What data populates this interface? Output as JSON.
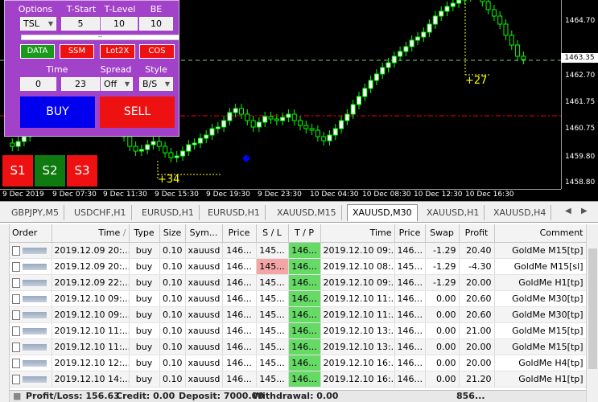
{
  "chart": {
    "price_labels": [
      "1464.70",
      "1463.35",
      "1462.70",
      "1461.75",
      "1460.75",
      "1459.80",
      "1458.80"
    ],
    "current_price": "1463.35",
    "time_labels": [
      "9 Dec 2019",
      "9 Dec 07:30",
      "9 Dec 11:30",
      "9 Dec 15:30",
      "9 Dec 19:30",
      "9 Dec 23:30",
      "10 Dec 04:30",
      "10 Dec 08:30",
      "10 Dec 12:30",
      "10 Dec 16:30"
    ],
    "pips_left": "+34",
    "pips_right": "+27",
    "colors": {
      "bull": "#00ff00",
      "bear": "#00ff00",
      "body_bear": "#000000",
      "body_bull": "#ffffff",
      "bid_line": "#ff0000",
      "ask_line": "#ffff00"
    }
  },
  "panel": {
    "labels": {
      "options": "Options",
      "tstart": "T-Start",
      "tlevel": "T-Level",
      "be": "BE",
      "time": "Time",
      "spread": "Spread",
      "style": "Style"
    },
    "options_value": "TSL",
    "tstart_value": "5",
    "tlevel_value": "10",
    "be_value": "10",
    "bar_text": "--",
    "mode_buttons": [
      "DATA",
      "SSM",
      "Lot2X",
      "COS"
    ],
    "time_from": "0",
    "time_to": "23",
    "spread_value": "Off",
    "style_value": "B/S",
    "buy_label": "BUY",
    "sell_label": "SELL",
    "s_buttons": [
      "S1",
      "S2",
      "S3"
    ]
  },
  "tabs": [
    "GBPJPY,M5",
    "USDCHF,H1",
    "EURUSD,H1",
    "EURUSD,H1",
    "XAUUSD,M15",
    "XAUUSD,M30",
    "XAUUSD,H1",
    "XAUUSD,H4"
  ],
  "active_tab": "XAUUSD,M30",
  "table": {
    "headers": [
      "Order",
      "Time",
      "Type",
      "Size",
      "Sym...",
      "Price",
      "S / L",
      "T / P",
      "Time",
      "Price",
      "Swap",
      "Profit",
      "Comment"
    ],
    "rows": [
      {
        "time": "2019.12.09 20:...",
        "type": "buy",
        "size": "0.10",
        "symbol": "xauusd",
        "price": "146...",
        "sl": "145...",
        "tp": "146...",
        "close_time": "2019.12.10 09:...",
        "close_price": "146...",
        "swap": "-1.29",
        "profit": "20.40",
        "comment": "GoldMe M15[tp]"
      },
      {
        "time": "2019.12.09 20:...",
        "type": "buy",
        "size": "0.10",
        "symbol": "xauusd",
        "price": "146...",
        "sl": "145...",
        "tp": "146...",
        "close_time": "2019.12.10 08:...",
        "close_price": "145...",
        "swap": "-1.29",
        "profit": "-4.30",
        "comment": "GoldMe M15[sl]"
      },
      {
        "time": "2019.12.09 22:...",
        "type": "buy",
        "size": "0.10",
        "symbol": "xauusd",
        "price": "146...",
        "sl": "145...",
        "tp": "146...",
        "close_time": "2019.12.10 09:...",
        "close_price": "146...",
        "swap": "-1.29",
        "profit": "20.00",
        "comment": "GoldMe H1[tp]"
      },
      {
        "time": "2019.12.10 09:...",
        "type": "buy",
        "size": "0.10",
        "symbol": "xauusd",
        "price": "146...",
        "sl": "145...",
        "tp": "146...",
        "close_time": "2019.12.10 11:...",
        "close_price": "146...",
        "swap": "0.00",
        "profit": "20.60",
        "comment": "GoldMe M30[tp]"
      },
      {
        "time": "2019.12.10 09:...",
        "type": "buy",
        "size": "0.10",
        "symbol": "xauusd",
        "price": "146...",
        "sl": "145...",
        "tp": "146...",
        "close_time": "2019.12.10 11:...",
        "close_price": "146...",
        "swap": "0.00",
        "profit": "20.60",
        "comment": "GoldMe M30[tp]"
      },
      {
        "time": "2019.12.10 11:...",
        "type": "buy",
        "size": "0.10",
        "symbol": "xauusd",
        "price": "146...",
        "sl": "145...",
        "tp": "146...",
        "close_time": "2019.12.10 13:...",
        "close_price": "146...",
        "swap": "0.00",
        "profit": "21.00",
        "comment": "GoldMe M15[tp]"
      },
      {
        "time": "2019.12.10 11:...",
        "type": "buy",
        "size": "0.10",
        "symbol": "xauusd",
        "price": "146...",
        "sl": "145...",
        "tp": "146...",
        "close_time": "2019.12.10 13:...",
        "close_price": "146...",
        "swap": "0.00",
        "profit": "20.00",
        "comment": "GoldMe M15[tp]"
      },
      {
        "time": "2019.12.10 12:...",
        "type": "buy",
        "size": "0.10",
        "symbol": "xauusd",
        "price": "146...",
        "sl": "145...",
        "tp": "146...",
        "close_time": "2019.12.10 16:...",
        "close_price": "146...",
        "swap": "0.00",
        "profit": "20.00",
        "comment": "GoldMe H4[tp]"
      },
      {
        "time": "2019.12.10 14:...",
        "type": "buy",
        "size": "0.10",
        "symbol": "xauusd",
        "price": "146...",
        "sl": "145...",
        "tp": "146...",
        "close_time": "2019.12.10 16:...",
        "close_price": "146...",
        "swap": "0.00",
        "profit": "21.20",
        "comment": "GoldMe H1[tp]"
      }
    ]
  },
  "summary": {
    "profit_loss": "Profit/Loss: 156.63",
    "credit": "Credit: 0.00",
    "deposit": "Deposit: 7000.00",
    "withdrawal": "Withdrawal: 0.00",
    "total": "856..."
  }
}
